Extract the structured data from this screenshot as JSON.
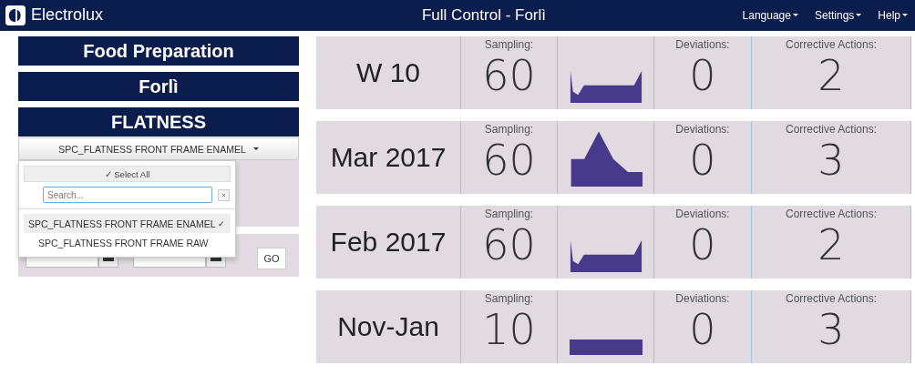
{
  "header": {
    "brand": "Electrolux",
    "title": "Full Control - Forlì",
    "menus": [
      {
        "label": "Language"
      },
      {
        "label": "Settings"
      },
      {
        "label": "Help"
      }
    ]
  },
  "sidebar": {
    "sections": [
      "Food Preparation",
      "Forlì",
      "FLATNESS"
    ],
    "dropdown": {
      "value": "SPC_FLATNESS FRONT FRAME ENAMEL",
      "expanded": true,
      "select_all": "✓ Select All",
      "search": {
        "placeholder": "Search..."
      },
      "clear": "×",
      "options": [
        {
          "label": "SPC_FLATNESS FRONT FRAME ENAMEL",
          "selected": true,
          "check": "✓"
        },
        {
          "label": "SPC_FLATNESS FRONT FRAME RAW",
          "selected": false
        }
      ]
    },
    "go": "GO"
  },
  "cards": [
    {
      "period": "W 10",
      "sampling_label": "Sampling:",
      "sampling": "60",
      "trend": {
        "kind": "dip"
      },
      "deviations_label": "Deviations:",
      "deviations": "0",
      "actions_label": "Corrective Actions:",
      "actions": "2"
    },
    {
      "period": "Mar 2017",
      "sampling_label": "Sampling:",
      "sampling": "60",
      "trend": {
        "kind": "peak"
      },
      "deviations_label": "Deviations:",
      "deviations": "0",
      "actions_label": "Corrective Actions:",
      "actions": "3"
    },
    {
      "period": "Feb 2017",
      "sampling_label": "Sampling:",
      "sampling": "60",
      "trend": {
        "kind": "dip"
      },
      "deviations_label": "Deviations:",
      "deviations": "0",
      "actions_label": "Corrective Actions:",
      "actions": "2"
    },
    {
      "period": "Nov-Jan",
      "sampling_label": "Sampling:",
      "sampling": "10",
      "trend": {
        "kind": "flat"
      },
      "deviations_label": "Deviations:",
      "deviations": "0",
      "actions_label": "Corrective Actions:",
      "actions": "3"
    }
  ]
}
